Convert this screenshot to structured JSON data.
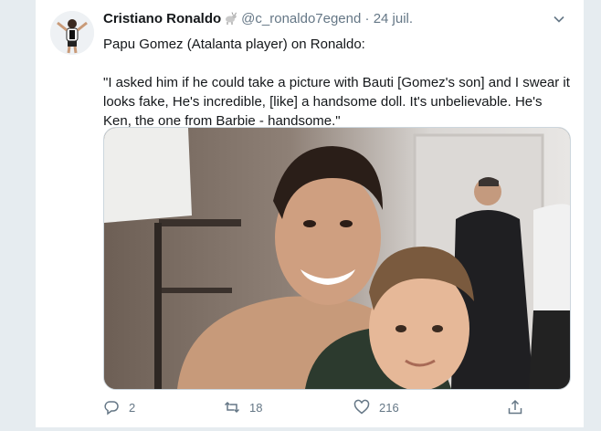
{
  "tweet": {
    "author_name": "Cristiano Ronaldo",
    "handle": "@c_ronaldo7egend",
    "separator": "·",
    "date": "24 juil.",
    "text": "Papu Gomez (Atalanta player) on Ronaldo:\n\n\"I asked him if he could take a picture with Bauti [Gomez's son] and I swear it looks fake, He's incredible, [like] a handsome doll. It's unbelievable. He's Ken, the one from Barbie - handsome.\"",
    "actions": {
      "reply_count": "2",
      "retweet_count": "18",
      "like_count": "216"
    }
  },
  "icons": {
    "verified": "goat-emoji-icon",
    "menu": "chevron-down-icon",
    "reply": "reply-bubble-icon",
    "retweet": "retweet-icon",
    "like": "heart-icon",
    "share": "share-icon"
  },
  "colors": {
    "text_primary": "#14171a",
    "text_secondary": "#657786",
    "border": "#e6ecf0"
  }
}
